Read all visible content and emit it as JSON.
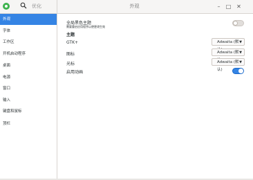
{
  "window": {
    "title": "外观"
  },
  "header": {
    "search_label": "优化"
  },
  "sidebar": {
    "items": [
      {
        "label": "外观",
        "active": true
      },
      {
        "label": "字体"
      },
      {
        "label": "工作区"
      },
      {
        "label": "开机启动程序"
      },
      {
        "label": "桌面"
      },
      {
        "label": "电源"
      },
      {
        "label": "窗口"
      },
      {
        "label": "输入"
      },
      {
        "label": "键盘和鼠标"
      },
      {
        "label": "顶栏"
      }
    ]
  },
  "main": {
    "dark_theme": {
      "title": "全局黑色主题",
      "subtitle": "需要重启应用程序以便更改生效",
      "enabled": false
    },
    "section_title": "主题",
    "rows": [
      {
        "label": "GTK+",
        "value": "Adwaita (默认)"
      },
      {
        "label": "图标",
        "value": "Adwaita (默认)"
      },
      {
        "label": "光标",
        "value": "Adwaita (默认)"
      }
    ],
    "animations": {
      "label": "启用动画",
      "enabled": true
    }
  },
  "icons": {
    "app": "gnome-tweaks-icon",
    "search": "search-icon",
    "minimize": "minimize-icon",
    "maximize": "maximize-icon",
    "close": "close-icon",
    "dropdown": "chevron-down-icon"
  },
  "colors": {
    "accent": "#3584e4",
    "app_icon": "#3fb34f"
  }
}
